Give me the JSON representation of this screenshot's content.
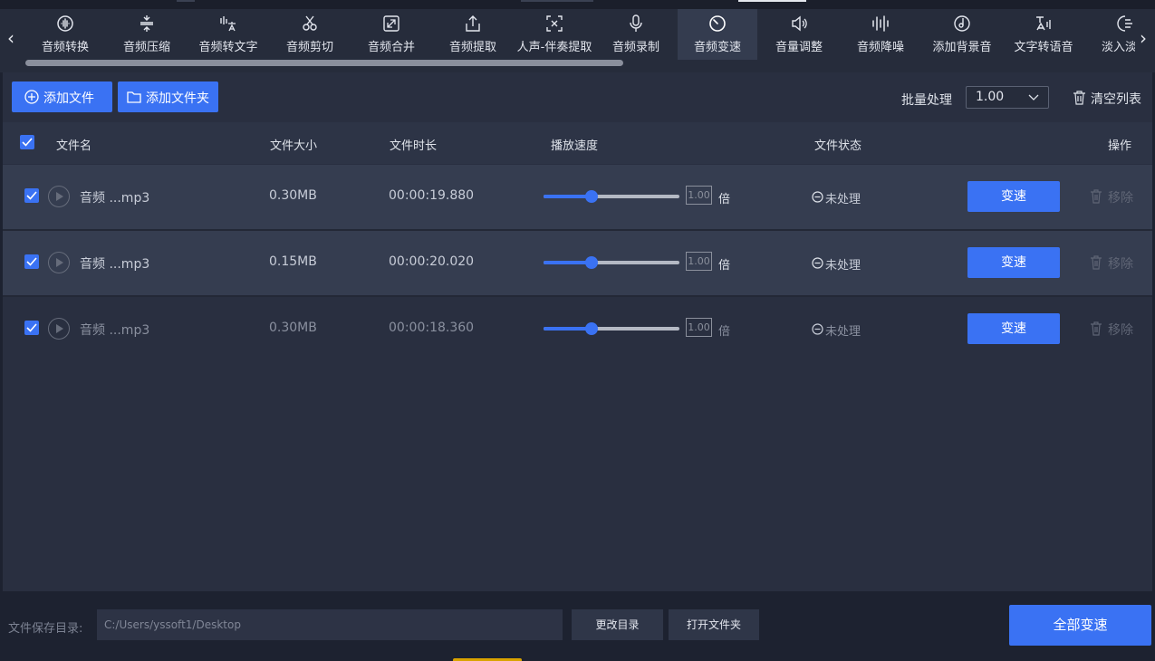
{
  "toolbar": {
    "items": [
      {
        "label": "音频转换",
        "icon": "waveform-circle-icon"
      },
      {
        "label": "音频压缩",
        "icon": "compress-icon"
      },
      {
        "label": "音频转文字",
        "icon": "speech-to-text-icon"
      },
      {
        "label": "音频剪切",
        "icon": "scissors-icon"
      },
      {
        "label": "音频合并",
        "icon": "merge-icon"
      },
      {
        "label": "音频提取",
        "icon": "export-icon"
      },
      {
        "label": "人声-伴奏提取",
        "icon": "vocal-extract-icon"
      },
      {
        "label": "音频录制",
        "icon": "microphone-icon"
      },
      {
        "label": "音频变速",
        "icon": "speedometer-icon",
        "active": true
      },
      {
        "label": "音量调整",
        "icon": "speaker-icon"
      },
      {
        "label": "音频降噪",
        "icon": "equalizer-icon"
      },
      {
        "label": "添加背景音",
        "icon": "music-disc-icon"
      },
      {
        "label": "文字转语音",
        "icon": "text-to-speech-icon"
      },
      {
        "label": "淡入淡出",
        "icon": "fade-icon"
      }
    ]
  },
  "actions": {
    "add_file": "添加文件",
    "add_folder": "添加文件夹",
    "batch_label": "批量处理",
    "batch_value": "1.00",
    "clear_list": "清空列表"
  },
  "table": {
    "headers": {
      "name": "文件名",
      "size": "文件大小",
      "duration": "文件时长",
      "speed": "播放速度",
      "status": "文件状态",
      "ops": "操作"
    },
    "rows": [
      {
        "name": "音频 ...mp3",
        "size": "0.30MB",
        "duration": "00:00:19.880",
        "speed": "1.00",
        "speed_fraction": 0.35,
        "unit": "倍",
        "status": "未处理",
        "action": "变速",
        "remove": "移除"
      },
      {
        "name": "音频 ...mp3",
        "size": "0.15MB",
        "duration": "00:00:20.020",
        "speed": "1.00",
        "speed_fraction": 0.35,
        "unit": "倍",
        "status": "未处理",
        "action": "变速",
        "remove": "移除"
      },
      {
        "name": "音频 ...mp3",
        "size": "0.30MB",
        "duration": "00:00:18.360",
        "speed": "1.00",
        "speed_fraction": 0.35,
        "unit": "倍",
        "status": "未处理",
        "action": "变速",
        "remove": "移除"
      }
    ]
  },
  "footer": {
    "save_label": "文件保存目录:",
    "save_path": "C:/Users/yssoft1/Desktop",
    "change_dir": "更改目录",
    "open_folder": "打开文件夹",
    "convert_all": "全部变速"
  },
  "colors": {
    "accent": "#3a72f3",
    "background": "#1d2230",
    "panel": "#292f40"
  }
}
